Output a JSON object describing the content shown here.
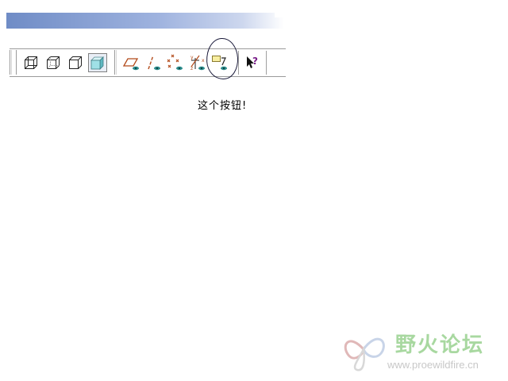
{
  "window": {
    "title": ""
  },
  "toolbar": {
    "buttons": [
      {
        "icon": "wireframe-display-icon"
      },
      {
        "icon": "hidden-line-display-icon"
      },
      {
        "icon": "no-hidden-display-icon"
      },
      {
        "icon": "shaded-display-icon",
        "pressed": true
      },
      {
        "icon": "datum-planes-display-icon"
      },
      {
        "icon": "datum-axes-display-icon"
      },
      {
        "icon": "datum-points-display-icon"
      },
      {
        "icon": "coordinate-systems-display-icon"
      },
      {
        "icon": "annotations-display-icon",
        "highlighted": true
      },
      {
        "icon": "context-help-icon"
      }
    ]
  },
  "caption": {
    "text": "这个按钮!"
  },
  "watermark": {
    "title": "野火论坛",
    "url": "www.proewildfire.cn"
  }
}
